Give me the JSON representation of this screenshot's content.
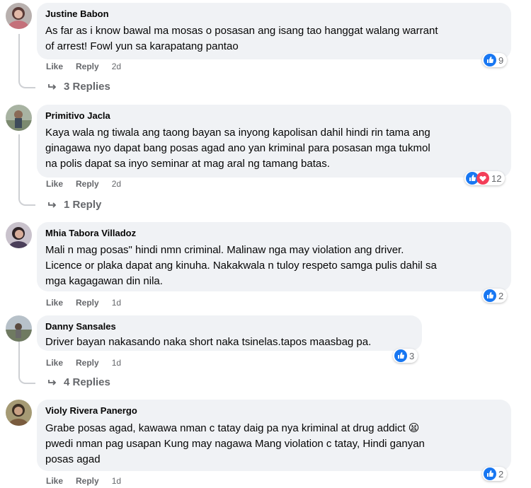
{
  "comments": [
    {
      "author": "Justine Babon",
      "lines": [
        "As far as i know bawal ma mosas o posasan ang isang tao hanggat walang warrant",
        "of arrest! Fowl yun sa karapatang pantao"
      ],
      "like": "Like",
      "reply": "Reply",
      "time": "2d",
      "reaction_count": "9",
      "reaction_icons": [
        "like-icon"
      ],
      "replies_label": "3 Replies"
    },
    {
      "author": "Primitivo Jacla",
      "lines": [
        "Kaya wala ng tiwala ang taong bayan sa inyong kapolisan dahil hindi rin tama ang",
        "ginagawa nyo dapat bang posas agad ano yan kriminal para posasan mga tukmol",
        "na polis dapat sa inyo seminar at mag aral ng tamang batas."
      ],
      "like": "Like",
      "reply": "Reply",
      "time": "2d",
      "reaction_count": "12",
      "reaction_icons": [
        "like-icon",
        "love-icon"
      ],
      "replies_label": "1 Reply"
    },
    {
      "author": "Mhia Tabora Villadoz",
      "lines": [
        "Mali n mag posas\" hindi nmn criminal. Malinaw nga may violation ang driver.",
        "Licence or plaka dapat ang kinuha. Nakakwala n tuloy respeto samga pulis dahil sa",
        "mga kagagawan din nila."
      ],
      "like": "Like",
      "reply": "Reply",
      "time": "1d",
      "reaction_count": "2",
      "reaction_icons": [
        "like-icon"
      ]
    },
    {
      "author": "Danny Sansales",
      "lines": [
        "Driver bayan nakasando naka short naka tsinelas.tapos maasbag pa."
      ],
      "like": "Like",
      "reply": "Reply",
      "time": "1d",
      "reaction_count": "3",
      "reaction_icons": [
        "like-icon"
      ],
      "replies_label": "4 Replies"
    },
    {
      "author": "Violy Rivera Panergo",
      "lines": [
        "Grabe posas agad, kawawa nman c tatay daig pa nya kriminal at drug addict",
        "pwedi nman pag usapan Kung may nagawa Mang violation c tatay, Hindi ganyan",
        "posas agad"
      ],
      "emoji": "😫",
      "like": "Like",
      "reply": "Reply",
      "time": "1d",
      "reaction_count": "2",
      "reaction_icons": [
        "like-icon"
      ]
    }
  ],
  "colors": {
    "bubble": "#f0f2f5",
    "meta_text": "#65676b",
    "like_blue": "#1877f2",
    "love_red": "#f33e58"
  }
}
